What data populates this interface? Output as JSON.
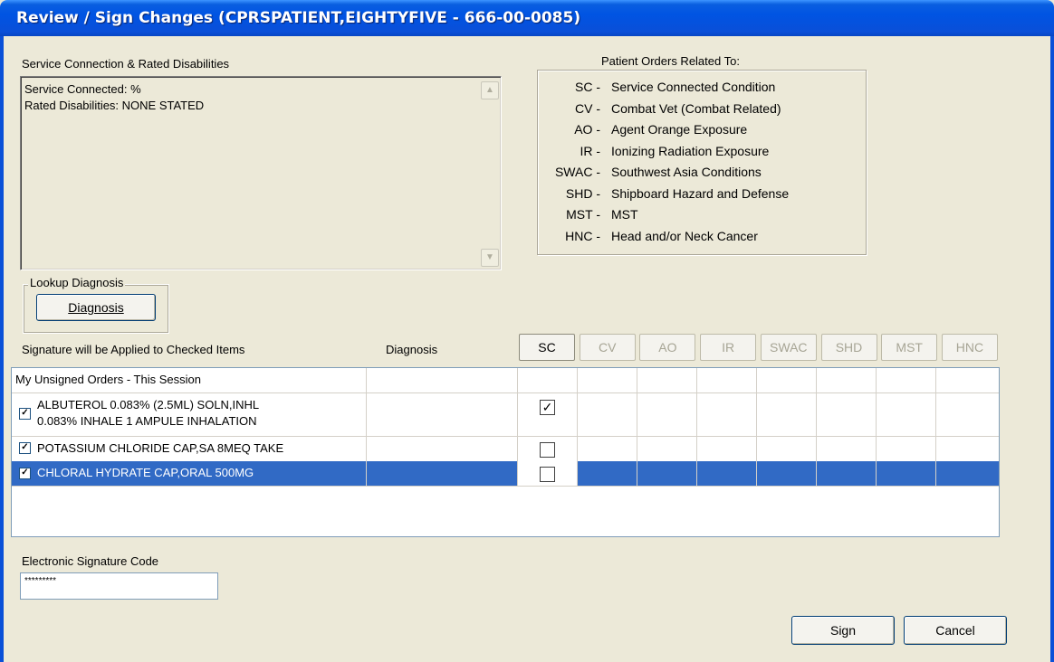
{
  "window": {
    "title": "Review / Sign Changes  (CPRSPATIENT,EIGHTYFIVE - 666-00-0085)"
  },
  "service_connection": {
    "label": "Service Connection & Rated Disabilities",
    "lines": [
      "Service Connected: %",
      "Rated Disabilities: NONE STATED"
    ]
  },
  "legend": {
    "title": "Patient Orders Related To:",
    "items": [
      {
        "code": "SC -",
        "text": "Service Connected Condition"
      },
      {
        "code": "CV -",
        "text": "Combat Vet (Combat Related)"
      },
      {
        "code": "AO -",
        "text": "Agent Orange Exposure"
      },
      {
        "code": "IR -",
        "text": "Ionizing Radiation Exposure"
      },
      {
        "code": "SWAC -",
        "text": "Southwest Asia Conditions"
      },
      {
        "code": "SHD -",
        "text": "Shipboard Hazard and Defense"
      },
      {
        "code": "MST -",
        "text": "MST"
      },
      {
        "code": "HNC -",
        "text": "Head and/or Neck Cancer"
      }
    ]
  },
  "lookup": {
    "group_label": "Lookup Diagnosis",
    "button_label": "Diagnosis"
  },
  "grid": {
    "header_label": "Signature will be Applied to Checked Items",
    "diagnosis_label": "Diagnosis",
    "columns": [
      "SC",
      "CV",
      "AO",
      "IR",
      "SWAC",
      "SHD",
      "MST",
      "HNC"
    ],
    "group_row": "My Unsigned Orders - This Session",
    "orders": [
      {
        "line1": "ALBUTEROL 0.083% (2.5ML) SOLN,INHL",
        "line2": "0.083%  INHALE 1 AMPULE INHALATION",
        "checked": true,
        "sc_checked": true
      },
      {
        "line1": "POTASSIUM CHLORIDE CAP,SA 8MEQ  TAKE",
        "checked": true,
        "sc_checked": false
      },
      {
        "line1": "CHLORAL HYDRATE CAP,ORAL 500MG",
        "checked": true,
        "sc_checked": false,
        "selected": true
      }
    ]
  },
  "esig": {
    "label": "Electronic Signature Code",
    "value": "*********"
  },
  "buttons": {
    "sign": "Sign",
    "cancel": "Cancel"
  },
  "colors": {
    "titlebar": "#0054e3",
    "dialog_bg": "#ece9d8",
    "selection": "#316ac5"
  }
}
